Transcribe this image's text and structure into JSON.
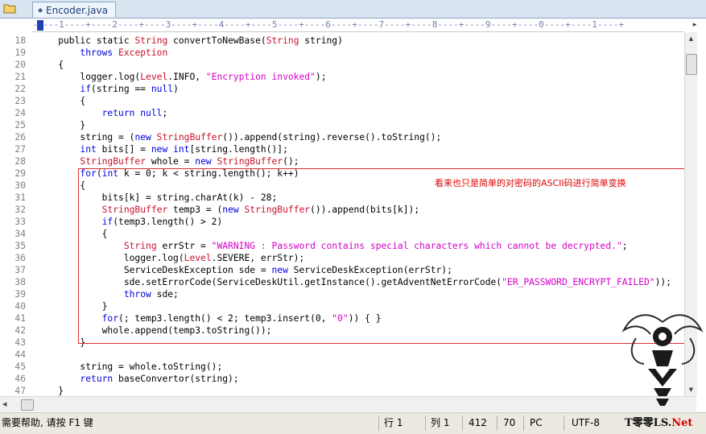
{
  "tab": {
    "label": "Encoder.java"
  },
  "ruler": "-+---1----+----2----+----3----+----4----+----5----+----6----+----7----+----8----+----9----+----0----+----1----+",
  "lines": [
    {
      "n": "18",
      "segs": [
        [
          "t",
          "    public static "
        ],
        [
          "y",
          "String"
        ],
        [
          "t",
          " convertToNewBase("
        ],
        [
          "y",
          "String"
        ],
        [
          "t",
          " string)"
        ]
      ]
    },
    {
      "n": "19",
      "segs": [
        [
          "t",
          "        "
        ],
        [
          "k",
          "throws"
        ],
        [
          "t",
          " "
        ],
        [
          "y",
          "Exception"
        ]
      ]
    },
    {
      "n": "20",
      "segs": [
        [
          "t",
          "    {"
        ]
      ]
    },
    {
      "n": "21",
      "segs": [
        [
          "t",
          "        logger.log("
        ],
        [
          "y",
          "Level"
        ],
        [
          "t",
          ".INFO, "
        ],
        [
          "s",
          "\"Encryption invoked\""
        ],
        [
          "t",
          ");"
        ]
      ]
    },
    {
      "n": "22",
      "segs": [
        [
          "t",
          "        "
        ],
        [
          "k",
          "if"
        ],
        [
          "t",
          "(string == "
        ],
        [
          "k",
          "null"
        ],
        [
          "t",
          ")"
        ]
      ]
    },
    {
      "n": "23",
      "segs": [
        [
          "t",
          "        {"
        ]
      ]
    },
    {
      "n": "24",
      "segs": [
        [
          "t",
          "            "
        ],
        [
          "k",
          "return null"
        ],
        [
          "t",
          ";"
        ]
      ]
    },
    {
      "n": "25",
      "segs": [
        [
          "t",
          "        }"
        ]
      ]
    },
    {
      "n": "26",
      "segs": [
        [
          "t",
          "        string = ("
        ],
        [
          "k",
          "new"
        ],
        [
          "t",
          " "
        ],
        [
          "y",
          "StringBuffer"
        ],
        [
          "t",
          "()).append(string).reverse().toString();"
        ]
      ]
    },
    {
      "n": "27",
      "segs": [
        [
          "t",
          "        "
        ],
        [
          "k",
          "int"
        ],
        [
          "t",
          " bits[] = "
        ],
        [
          "k",
          "new int"
        ],
        [
          "t",
          "[string.length()];"
        ]
      ]
    },
    {
      "n": "28",
      "segs": [
        [
          "t",
          "        "
        ],
        [
          "y",
          "StringBuffer"
        ],
        [
          "t",
          " whole = "
        ],
        [
          "k",
          "new"
        ],
        [
          "t",
          " "
        ],
        [
          "y",
          "StringBuffer"
        ],
        [
          "t",
          "();"
        ]
      ]
    },
    {
      "n": "29",
      "segs": [
        [
          "t",
          "        "
        ],
        [
          "k",
          "for"
        ],
        [
          "t",
          "("
        ],
        [
          "k",
          "int"
        ],
        [
          "t",
          " k = 0; k < string.length(); k++)"
        ]
      ]
    },
    {
      "n": "30",
      "segs": [
        [
          "t",
          "        {"
        ]
      ]
    },
    {
      "n": "31",
      "segs": [
        [
          "t",
          "            bits[k] = string.charAt(k) - 28;"
        ]
      ]
    },
    {
      "n": "32",
      "segs": [
        [
          "t",
          "            "
        ],
        [
          "y",
          "StringBuffer"
        ],
        [
          "t",
          " temp3 = ("
        ],
        [
          "k",
          "new"
        ],
        [
          "t",
          " "
        ],
        [
          "y",
          "StringBuffer"
        ],
        [
          "t",
          "()).append(bits[k]);"
        ]
      ]
    },
    {
      "n": "33",
      "segs": [
        [
          "t",
          "            "
        ],
        [
          "k",
          "if"
        ],
        [
          "t",
          "(temp3.length() > 2)"
        ]
      ]
    },
    {
      "n": "34",
      "segs": [
        [
          "t",
          "            {"
        ]
      ]
    },
    {
      "n": "35",
      "segs": [
        [
          "t",
          "                "
        ],
        [
          "y",
          "String"
        ],
        [
          "t",
          " errStr = "
        ],
        [
          "s",
          "\"WARNING : Password contains special characters which cannot be decrypted.\""
        ],
        [
          "t",
          ";"
        ]
      ]
    },
    {
      "n": "36",
      "segs": [
        [
          "t",
          "                logger.log("
        ],
        [
          "y",
          "Level"
        ],
        [
          "t",
          ".SEVERE, errStr);"
        ]
      ]
    },
    {
      "n": "37",
      "segs": [
        [
          "t",
          "                ServiceDeskException sde = "
        ],
        [
          "k",
          "new"
        ],
        [
          "t",
          " ServiceDeskException(errStr);"
        ]
      ]
    },
    {
      "n": "38",
      "segs": [
        [
          "t",
          "                sde.setErrorCode(ServiceDeskUtil.getInstance().getAdventNetErrorCode("
        ],
        [
          "s",
          "\"ER_PASSWORD_ENCRYPT_FAILED\""
        ],
        [
          "t",
          "));"
        ]
      ]
    },
    {
      "n": "39",
      "segs": [
        [
          "t",
          "                "
        ],
        [
          "k",
          "throw"
        ],
        [
          "t",
          " sde;"
        ]
      ]
    },
    {
      "n": "40",
      "segs": [
        [
          "t",
          "            }"
        ]
      ]
    },
    {
      "n": "41",
      "segs": [
        [
          "t",
          "            "
        ],
        [
          "k",
          "for"
        ],
        [
          "t",
          "(; temp3.length() < 2; temp3.insert(0, "
        ],
        [
          "s",
          "\"0\""
        ],
        [
          "t",
          ")) { }"
        ]
      ]
    },
    {
      "n": "42",
      "segs": [
        [
          "t",
          "            whole.append(temp3.toString());"
        ]
      ]
    },
    {
      "n": "43",
      "segs": [
        [
          "t",
          "        }"
        ]
      ]
    },
    {
      "n": "44",
      "segs": [
        [
          "t",
          ""
        ]
      ]
    },
    {
      "n": "45",
      "segs": [
        [
          "t",
          "        string = whole.toString();"
        ]
      ]
    },
    {
      "n": "46",
      "segs": [
        [
          "t",
          "        "
        ],
        [
          "k",
          "return"
        ],
        [
          "t",
          " baseConvertor(string);"
        ]
      ]
    },
    {
      "n": "47",
      "segs": [
        [
          "t",
          "    }"
        ]
      ]
    }
  ],
  "annotation": "看来也只是简单的对密码的ASCII码进行简单变换",
  "status": {
    "help": "需要帮助, 请按 F1 键",
    "row": "行 1",
    "col": "列 1",
    "num1": "412",
    "num2": "70",
    "mode": "PC",
    "encoding": "UTF-8"
  },
  "watermark": {
    "prefix": "T零零LS.",
    "suffix": "Net"
  },
  "colors": {
    "keyword": "#0000dd",
    "type": "#c8102e",
    "string": "#d400c8",
    "annotation": "#e00000"
  }
}
